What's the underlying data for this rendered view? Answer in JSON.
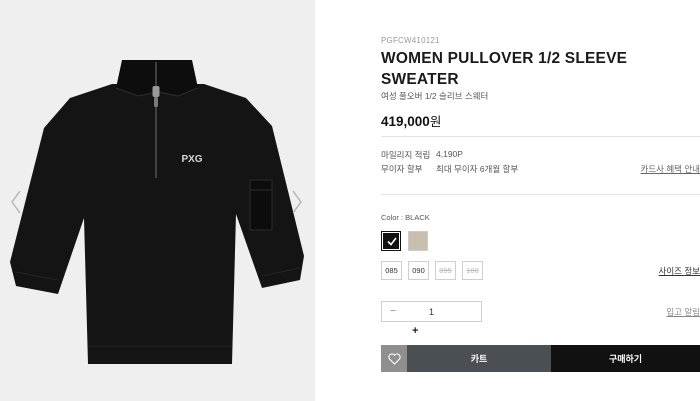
{
  "product": {
    "sku": "PGFCW410121",
    "title": "WOMEN PULLOVER 1/2 SLEEVE SWEATER",
    "subtitle": "여성 풀오버 1/2 슬리브 스웨터",
    "price": "419,000",
    "price_unit": "원",
    "logo_text": "PXG"
  },
  "meta": {
    "mileage_label": "마일리지 적립",
    "mileage_value": "4,190P",
    "installment_label": "무이자 할부",
    "installment_value": "최대 무이자 6개월 할부",
    "card_link": "카드사 혜택 안내"
  },
  "options": {
    "color_label": "Color : BLACK",
    "colors": [
      {
        "name": "black",
        "hex": "#111111",
        "selected": true
      },
      {
        "name": "beige",
        "hex": "#c8bfae",
        "selected": false
      }
    ],
    "sizes": [
      {
        "label": "085",
        "available": true
      },
      {
        "label": "090",
        "available": true
      },
      {
        "label": "095",
        "available": false
      },
      {
        "label": "100",
        "available": false
      }
    ],
    "size_guide": "사이즈 정보"
  },
  "quantity": {
    "minus": "−",
    "value": "1",
    "plus": "+",
    "restock_link": "입고 알림"
  },
  "actions": {
    "wishlist_icon": "heart-icon",
    "cart_label": "카트",
    "buy_label": "구매하기"
  }
}
